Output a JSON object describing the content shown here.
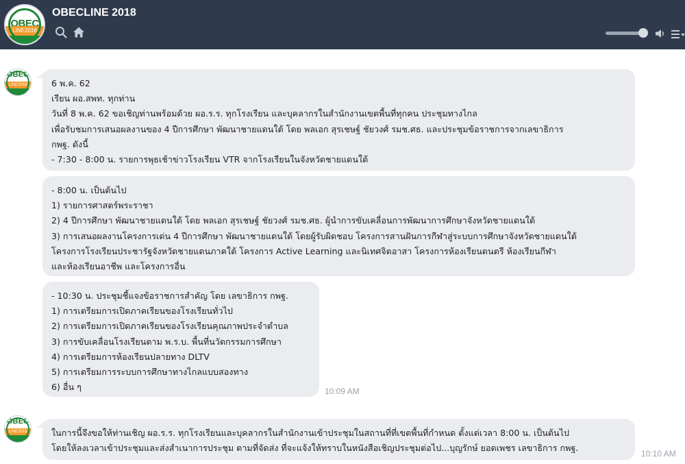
{
  "app": {
    "title": "OBECLINE 2018",
    "logo_text": "OBEC",
    "logo_subtext": "LINE2018"
  },
  "header": {
    "icons": [
      "search-icon",
      "home-icon",
      "volume-slider",
      "speaker-icon",
      "menu-icon"
    ],
    "volume_level": 0.85
  },
  "colors": {
    "header_bg": "#2f3b4c",
    "bubble_bg": "#eaecef",
    "logo_green": "#1f8a3a",
    "logo_orange": "#f29a2e",
    "timestamp": "#9aa1aa"
  },
  "messages": [
    {
      "sender_avatar": "OBEC",
      "lines": [
        "6 พ.ค. 62",
        "เรียน ผอ.สพท. ทุกท่าน",
        "วันที่ 8 พ.ค. 62 ขอเชิญท่านพร้อมด้วย ผอ.ร.ร. ทุกโรงเรียน และบุคลากรในสำนักงานเขตพื้นที่ทุกคน ประชุมทางไกล",
        "เพื่อรับชมการเสนอผลงานของ 4 ปีการศึกษา พัฒนาชายแดนใต้ โดย พลเอก สุรเชษฐ์ ชัยวงศ์ รมช.ศธ. และประชุมข้อราชการจากเลขาธิการ",
        "กพฐ. ดังนี้",
        "- 7:30 - 8:00 น. รายการพุธเช้าข่าวโรงเรียน  VTR จากโรงเรียนในจังหวัดชายแดนใต้"
      ]
    },
    {
      "lines": [
        "- 8:00 น. เป็นต้นไป",
        "1) รายการศาสตร์พระราชา",
        "2) 4 ปีการศึกษา พัฒนาชายแดนใต้ โดย พลเอก สุรเชษฐ์ ชัยวงศ์ รมช.ศธ. ผู้นำการขับเคลื่อนการพัฒนาการศึกษาจังหวัดชายแดนใต้",
        "3) การเสนอผลงานโครงการเด่น 4 ปีการศึกษา พัฒนาชายแดนใต้ โดยผู้รับผิดชอบ โครงการสานฝันการกีฬาสู่ระบบการศึกษาจังหวัดชายแดนใต้",
        "โครงการโรงเรียนประชารัฐจังหวัดชายแดนภาคใต้ โครงการ Active Learning และนิเทศจิตอาสา โครงการห้องเรียนดนตรี ห้องเรียนกีฬา",
        "และห้องเรียนอาชีพ และโครงการอื่น"
      ]
    },
    {
      "lines": [
        "- 10:30 น. ประชุมชี้แจงข้อราชการสำคัญ โดย เลขาธิการ กพฐ.",
        "1) การเตรียมการเปิดภาคเรียนของโรงเรียนทั่วไป",
        "2) การเตรียมการเปิดภาคเรียนของโรงเรียนคุณภาพประจำตำบล",
        "3) การขับเคลื่อนโรงเรียนตาม พ.ร.บ. พื้นที่นวัตกรรมการศึกษา",
        "4) การเตรียมการห้องเรียนปลายทาง DLTV",
        "5) การเตรียมการระบบการศึกษาทางไกลแบบสองทาง",
        "6) อื่น ๆ"
      ],
      "time": "10:09 AM"
    },
    {
      "sender_avatar": "OBEC",
      "lines": [
        "ในการนี้จึงขอให้ท่านเชิญ ผอ.ร.ร. ทุกโรงเรียนและบุคลากรในสำนักงานเข้าประชุมในสถานที่ที่เขตพื้นที่กำหนด ตั้งแต่เวลา 8:00 น. เป็นต้นไป",
        "โดยให้ลงเวลาเข้าประชุมและส่งสำเนาการประชุม ตามที่จัดส่ง ที่จะแจ้งให้ทราบในหนังสือเชิญประชุมต่อไป...บุญรักษ์ ยอดเพชร เลขาธิการ กพฐ."
      ],
      "time": "10:10 AM"
    }
  ]
}
